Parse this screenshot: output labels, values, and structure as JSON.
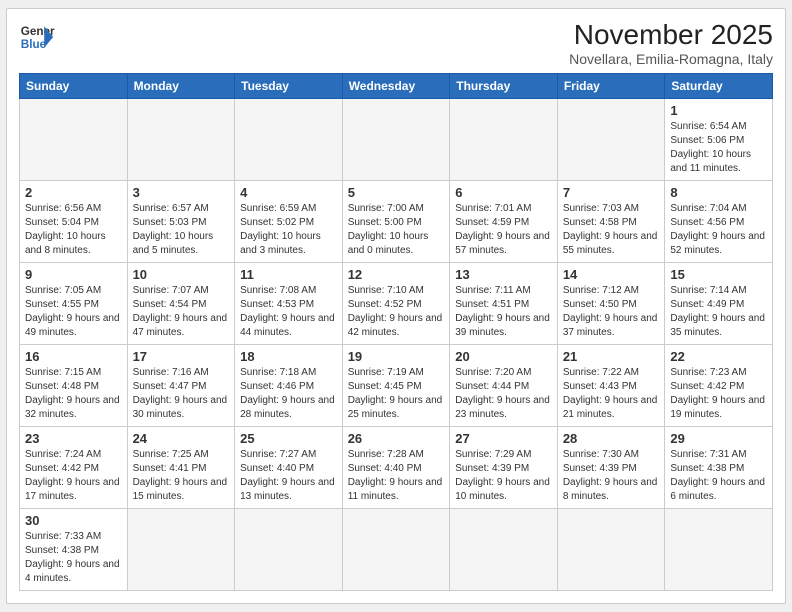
{
  "header": {
    "logo_general": "General",
    "logo_blue": "Blue",
    "month_title": "November 2025",
    "location": "Novellara, Emilia-Romagna, Italy"
  },
  "weekdays": [
    "Sunday",
    "Monday",
    "Tuesday",
    "Wednesday",
    "Thursday",
    "Friday",
    "Saturday"
  ],
  "weeks": [
    [
      {
        "day": "",
        "info": ""
      },
      {
        "day": "",
        "info": ""
      },
      {
        "day": "",
        "info": ""
      },
      {
        "day": "",
        "info": ""
      },
      {
        "day": "",
        "info": ""
      },
      {
        "day": "",
        "info": ""
      },
      {
        "day": "1",
        "info": "Sunrise: 6:54 AM\nSunset: 5:06 PM\nDaylight: 10 hours and 11 minutes."
      }
    ],
    [
      {
        "day": "2",
        "info": "Sunrise: 6:56 AM\nSunset: 5:04 PM\nDaylight: 10 hours and 8 minutes."
      },
      {
        "day": "3",
        "info": "Sunrise: 6:57 AM\nSunset: 5:03 PM\nDaylight: 10 hours and 5 minutes."
      },
      {
        "day": "4",
        "info": "Sunrise: 6:59 AM\nSunset: 5:02 PM\nDaylight: 10 hours and 3 minutes."
      },
      {
        "day": "5",
        "info": "Sunrise: 7:00 AM\nSunset: 5:00 PM\nDaylight: 10 hours and 0 minutes."
      },
      {
        "day": "6",
        "info": "Sunrise: 7:01 AM\nSunset: 4:59 PM\nDaylight: 9 hours and 57 minutes."
      },
      {
        "day": "7",
        "info": "Sunrise: 7:03 AM\nSunset: 4:58 PM\nDaylight: 9 hours and 55 minutes."
      },
      {
        "day": "8",
        "info": "Sunrise: 7:04 AM\nSunset: 4:56 PM\nDaylight: 9 hours and 52 minutes."
      }
    ],
    [
      {
        "day": "9",
        "info": "Sunrise: 7:05 AM\nSunset: 4:55 PM\nDaylight: 9 hours and 49 minutes."
      },
      {
        "day": "10",
        "info": "Sunrise: 7:07 AM\nSunset: 4:54 PM\nDaylight: 9 hours and 47 minutes."
      },
      {
        "day": "11",
        "info": "Sunrise: 7:08 AM\nSunset: 4:53 PM\nDaylight: 9 hours and 44 minutes."
      },
      {
        "day": "12",
        "info": "Sunrise: 7:10 AM\nSunset: 4:52 PM\nDaylight: 9 hours and 42 minutes."
      },
      {
        "day": "13",
        "info": "Sunrise: 7:11 AM\nSunset: 4:51 PM\nDaylight: 9 hours and 39 minutes."
      },
      {
        "day": "14",
        "info": "Sunrise: 7:12 AM\nSunset: 4:50 PM\nDaylight: 9 hours and 37 minutes."
      },
      {
        "day": "15",
        "info": "Sunrise: 7:14 AM\nSunset: 4:49 PM\nDaylight: 9 hours and 35 minutes."
      }
    ],
    [
      {
        "day": "16",
        "info": "Sunrise: 7:15 AM\nSunset: 4:48 PM\nDaylight: 9 hours and 32 minutes."
      },
      {
        "day": "17",
        "info": "Sunrise: 7:16 AM\nSunset: 4:47 PM\nDaylight: 9 hours and 30 minutes."
      },
      {
        "day": "18",
        "info": "Sunrise: 7:18 AM\nSunset: 4:46 PM\nDaylight: 9 hours and 28 minutes."
      },
      {
        "day": "19",
        "info": "Sunrise: 7:19 AM\nSunset: 4:45 PM\nDaylight: 9 hours and 25 minutes."
      },
      {
        "day": "20",
        "info": "Sunrise: 7:20 AM\nSunset: 4:44 PM\nDaylight: 9 hours and 23 minutes."
      },
      {
        "day": "21",
        "info": "Sunrise: 7:22 AM\nSunset: 4:43 PM\nDaylight: 9 hours and 21 minutes."
      },
      {
        "day": "22",
        "info": "Sunrise: 7:23 AM\nSunset: 4:42 PM\nDaylight: 9 hours and 19 minutes."
      }
    ],
    [
      {
        "day": "23",
        "info": "Sunrise: 7:24 AM\nSunset: 4:42 PM\nDaylight: 9 hours and 17 minutes."
      },
      {
        "day": "24",
        "info": "Sunrise: 7:25 AM\nSunset: 4:41 PM\nDaylight: 9 hours and 15 minutes."
      },
      {
        "day": "25",
        "info": "Sunrise: 7:27 AM\nSunset: 4:40 PM\nDaylight: 9 hours and 13 minutes."
      },
      {
        "day": "26",
        "info": "Sunrise: 7:28 AM\nSunset: 4:40 PM\nDaylight: 9 hours and 11 minutes."
      },
      {
        "day": "27",
        "info": "Sunrise: 7:29 AM\nSunset: 4:39 PM\nDaylight: 9 hours and 10 minutes."
      },
      {
        "day": "28",
        "info": "Sunrise: 7:30 AM\nSunset: 4:39 PM\nDaylight: 9 hours and 8 minutes."
      },
      {
        "day": "29",
        "info": "Sunrise: 7:31 AM\nSunset: 4:38 PM\nDaylight: 9 hours and 6 minutes."
      }
    ],
    [
      {
        "day": "30",
        "info": "Sunrise: 7:33 AM\nSunset: 4:38 PM\nDaylight: 9 hours and 4 minutes."
      },
      {
        "day": "",
        "info": ""
      },
      {
        "day": "",
        "info": ""
      },
      {
        "day": "",
        "info": ""
      },
      {
        "day": "",
        "info": ""
      },
      {
        "day": "",
        "info": ""
      },
      {
        "day": "",
        "info": ""
      }
    ]
  ]
}
